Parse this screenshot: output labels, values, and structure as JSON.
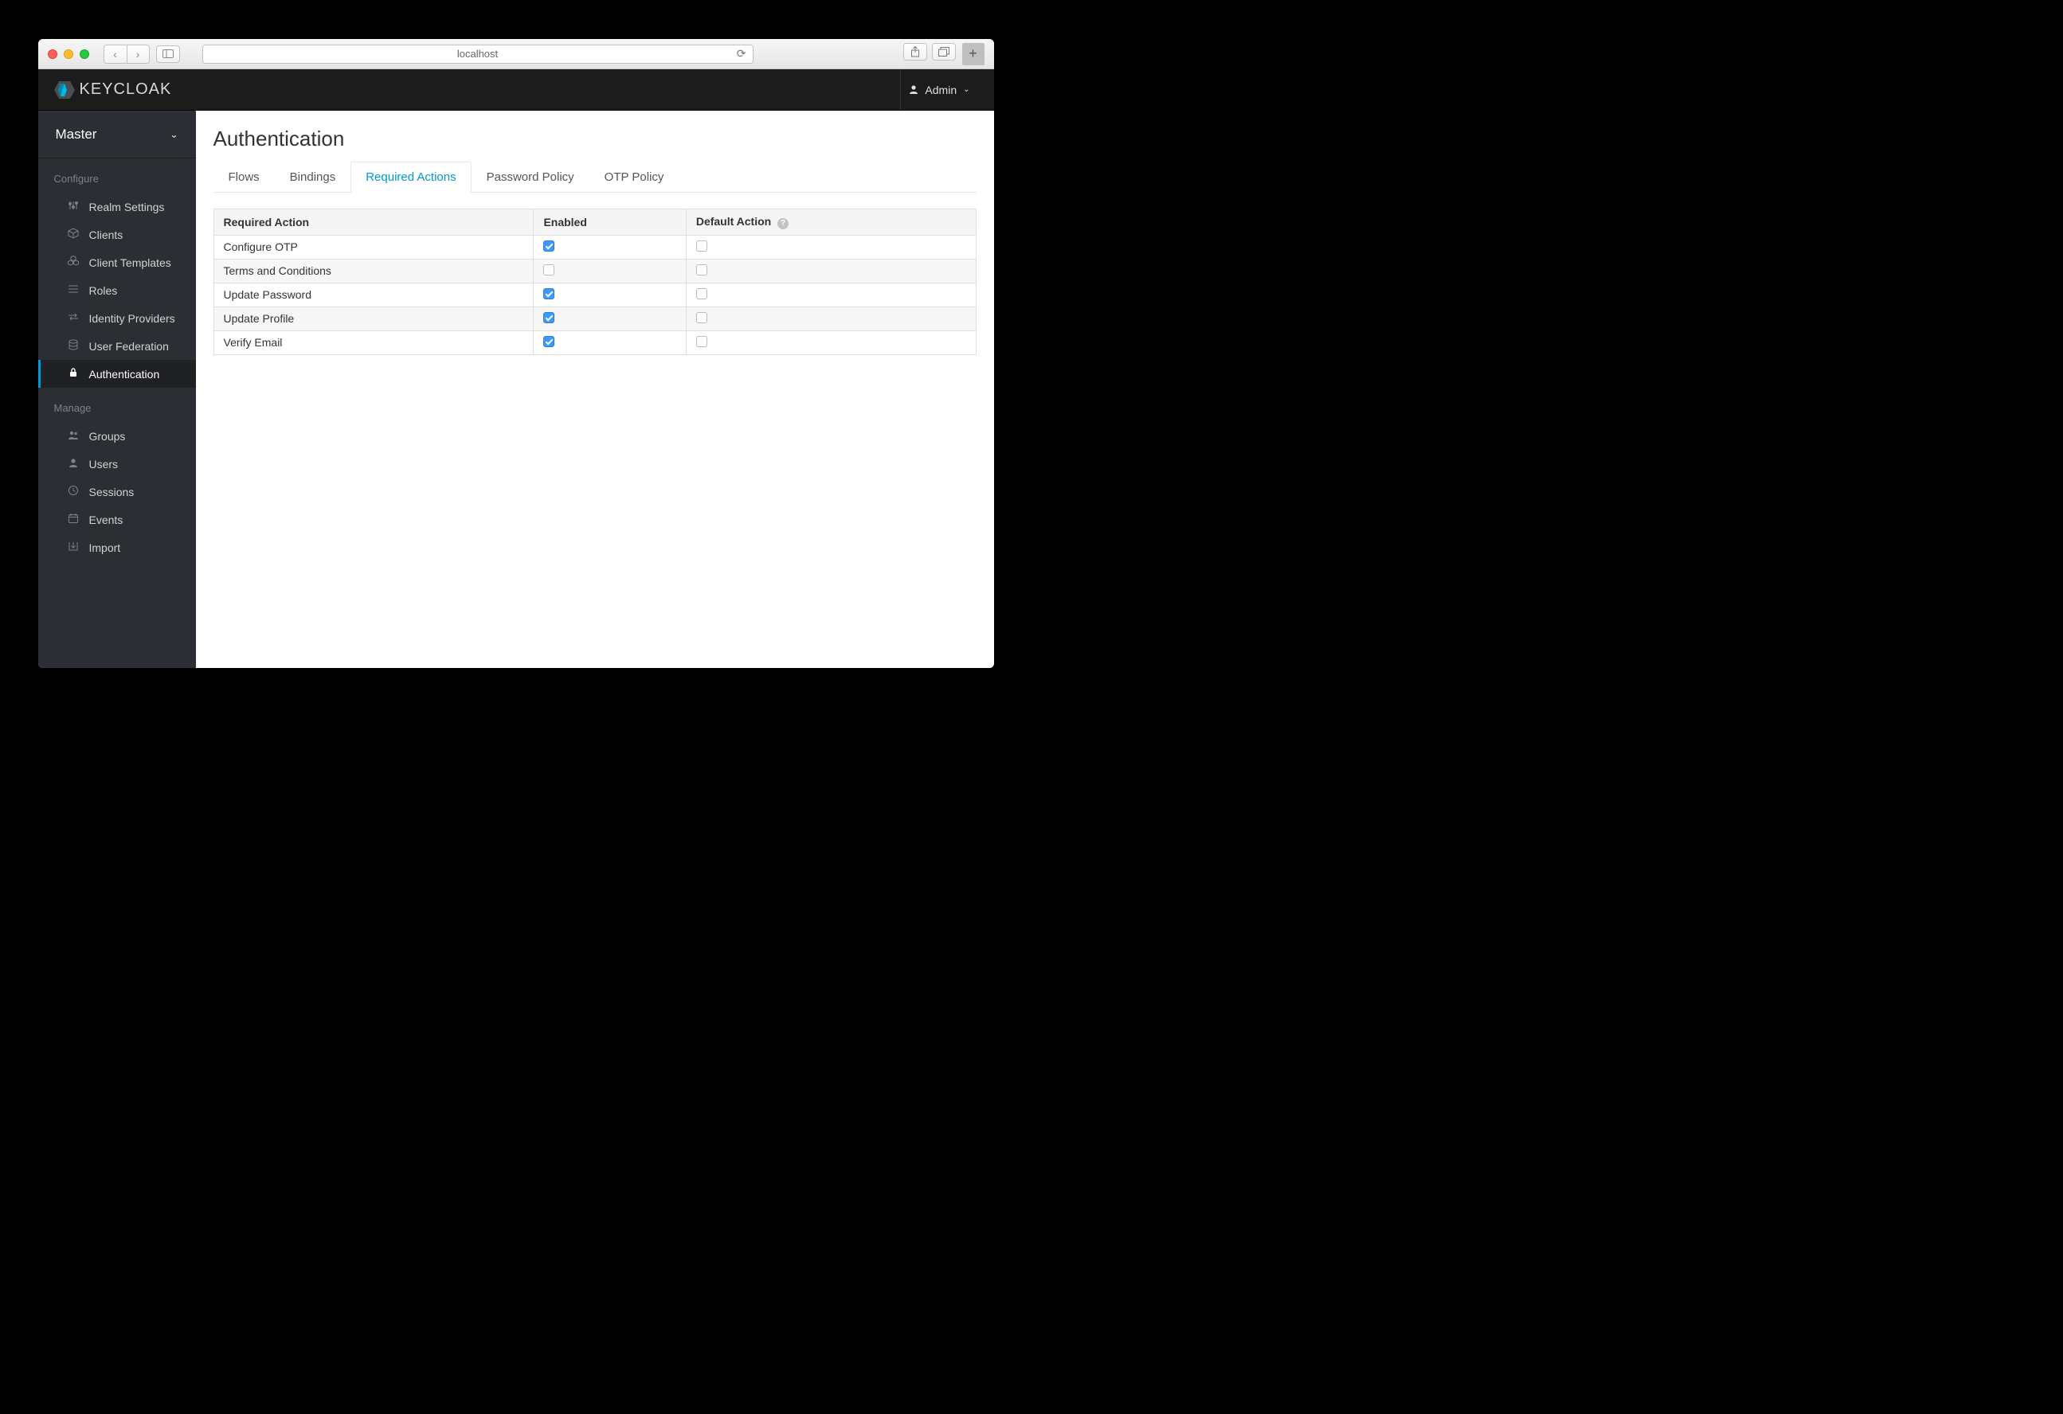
{
  "browser": {
    "url": "localhost"
  },
  "header": {
    "brand": "KEYCLOAK",
    "user_label": "Admin"
  },
  "sidebar": {
    "realm": "Master",
    "sections": [
      {
        "heading": "Configure",
        "items": [
          {
            "label": "Realm Settings",
            "icon": "sliders",
            "active": false
          },
          {
            "label": "Clients",
            "icon": "cube",
            "active": false
          },
          {
            "label": "Client Templates",
            "icon": "cubes",
            "active": false
          },
          {
            "label": "Roles",
            "icon": "list",
            "active": false
          },
          {
            "label": "Identity Providers",
            "icon": "exchange",
            "active": false
          },
          {
            "label": "User Federation",
            "icon": "database",
            "active": false
          },
          {
            "label": "Authentication",
            "icon": "lock",
            "active": true
          }
        ]
      },
      {
        "heading": "Manage",
        "items": [
          {
            "label": "Groups",
            "icon": "users",
            "active": false
          },
          {
            "label": "Users",
            "icon": "user",
            "active": false
          },
          {
            "label": "Sessions",
            "icon": "clock",
            "active": false
          },
          {
            "label": "Events",
            "icon": "calendar",
            "active": false
          },
          {
            "label": "Import",
            "icon": "import",
            "active": false
          }
        ]
      }
    ]
  },
  "page": {
    "title": "Authentication",
    "tabs": [
      {
        "label": "Flows",
        "active": false
      },
      {
        "label": "Bindings",
        "active": false
      },
      {
        "label": "Required Actions",
        "active": true
      },
      {
        "label": "Password Policy",
        "active": false
      },
      {
        "label": "OTP Policy",
        "active": false
      }
    ],
    "table": {
      "headers": {
        "action": "Required Action",
        "enabled": "Enabled",
        "default": "Default Action"
      },
      "rows": [
        {
          "name": "Configure OTP",
          "enabled": true,
          "default": false
        },
        {
          "name": "Terms and Conditions",
          "enabled": false,
          "default": false
        },
        {
          "name": "Update Password",
          "enabled": true,
          "default": false
        },
        {
          "name": "Update Profile",
          "enabled": true,
          "default": false
        },
        {
          "name": "Verify Email",
          "enabled": true,
          "default": false
        }
      ]
    }
  }
}
